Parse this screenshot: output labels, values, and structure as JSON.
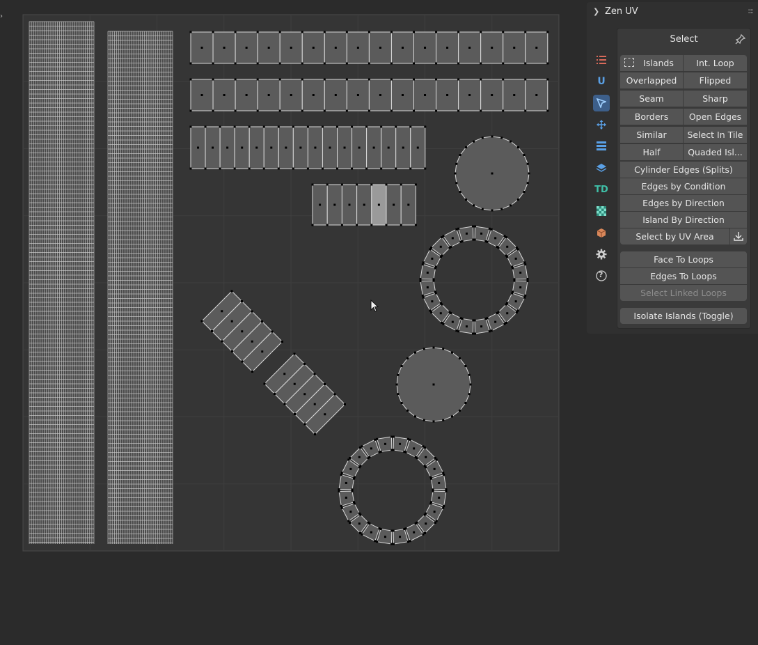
{
  "panel": {
    "title": "Zen UV",
    "grip": "::::",
    "expand_icon": "chevron-down-icon"
  },
  "tabs": [
    {
      "name": "tab-list",
      "icon": "list-icon"
    },
    {
      "name": "tab-unwrap",
      "icon": "u-icon",
      "label": "U"
    },
    {
      "name": "tab-select",
      "icon": "cursor-arrow-icon",
      "active": true
    },
    {
      "name": "tab-transform",
      "icon": "move-arrows-icon"
    },
    {
      "name": "tab-stack",
      "icon": "stack-icon"
    },
    {
      "name": "tab-layers",
      "icon": "layers-icon"
    },
    {
      "name": "tab-texel-density",
      "icon": "td-icon",
      "label": "TD"
    },
    {
      "name": "tab-checker",
      "icon": "checker-icon"
    },
    {
      "name": "tab-trimsheet",
      "icon": "box-icon"
    },
    {
      "name": "tab-preferences",
      "icon": "gear-icon"
    },
    {
      "name": "tab-help",
      "icon": "help-icon",
      "label": "?"
    }
  ],
  "select": {
    "title": "Select",
    "pin_icon": "pin-icon",
    "rows": [
      [
        "Islands",
        "Int. Loop"
      ],
      [
        "Overlapped",
        "Flipped"
      ],
      [
        "Seam",
        "Sharp"
      ],
      [
        "Borders",
        "Open Edges"
      ],
      [
        "Similar",
        "Select In Tile"
      ],
      [
        "Half",
        "Quaded Isl..."
      ]
    ],
    "full_rows": [
      "Cylinder Edges (Splits)",
      "Edges by Condition",
      "Edges by Direction",
      "Island By Direction"
    ],
    "uv_area": "Select by UV Area",
    "uv_area_icon": "download-icon",
    "loops": [
      "Face To Loops",
      "Edges To Loops",
      "Select Linked Loops"
    ],
    "loops_disabled": "Select Linked Loops",
    "isolate": "Isolate Islands (Toggle)"
  },
  "colors": {
    "background": "#2b2b2b",
    "uv_area": "#353535",
    "grid": "#3f3f3f",
    "face": "#5b5b5b",
    "selected_face": "#9a9a9a",
    "edge": "#d9d9d9",
    "vertex": "#000000",
    "accent": "#3d5f8a"
  }
}
